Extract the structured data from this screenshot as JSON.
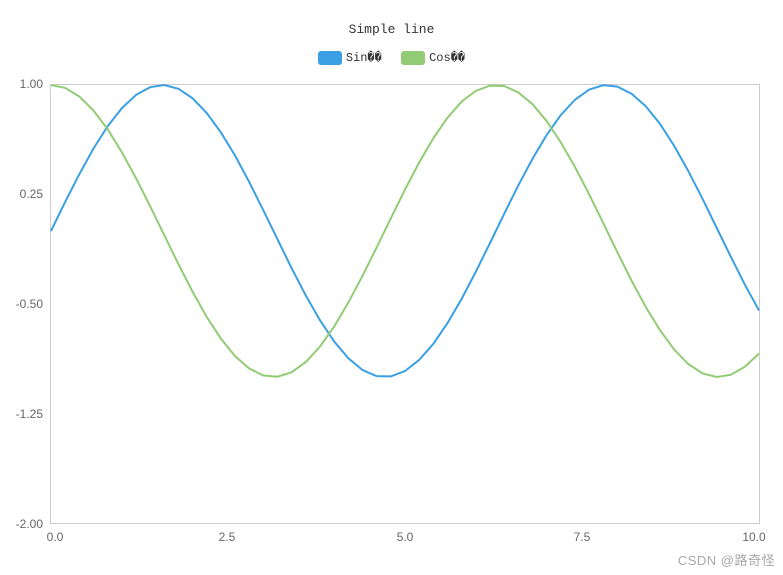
{
  "chart_data": {
    "type": "line",
    "title": "Simple line",
    "xlabel": "",
    "ylabel": "",
    "xlim": [
      0.0,
      10.0
    ],
    "ylim": [
      -2.0,
      1.0
    ],
    "x_ticks": [
      0.0,
      2.5,
      5.0,
      7.5,
      10.0
    ],
    "y_ticks": [
      1.0,
      0.25,
      -0.5,
      -1.25,
      -2.0
    ],
    "x_tick_labels": [
      "0.0",
      "2.5",
      "5.0",
      "7.5",
      "10.0"
    ],
    "y_tick_labels": [
      "1.00",
      "0.25",
      "-0.50",
      "-1.25",
      "-2.00"
    ],
    "x": [
      0.0,
      0.2,
      0.4,
      0.6,
      0.8,
      1.0,
      1.2,
      1.4,
      1.6,
      1.8,
      2.0,
      2.2,
      2.4,
      2.6,
      2.8,
      3.0,
      3.2,
      3.4,
      3.6,
      3.8,
      4.0,
      4.2,
      4.4,
      4.6,
      4.8,
      5.0,
      5.2,
      5.4,
      5.6,
      5.8,
      6.0,
      6.2,
      6.4,
      6.6,
      6.8,
      7.0,
      7.2,
      7.4,
      7.6,
      7.8,
      8.0,
      8.2,
      8.4,
      8.6,
      8.8,
      9.0,
      9.2,
      9.4,
      9.6,
      9.8,
      10.0
    ],
    "series": [
      {
        "name": "Sin��",
        "color": "#3ba0e3",
        "values": [
          0.0,
          0.199,
          0.389,
          0.565,
          0.717,
          0.841,
          0.932,
          0.985,
          1.0,
          0.974,
          0.909,
          0.808,
          0.675,
          0.516,
          0.335,
          0.141,
          -0.058,
          -0.256,
          -0.443,
          -0.612,
          -0.757,
          -0.872,
          -0.952,
          -0.994,
          -0.996,
          -0.959,
          -0.883,
          -0.773,
          -0.631,
          -0.465,
          -0.279,
          -0.083,
          0.117,
          0.312,
          0.494,
          0.657,
          0.794,
          0.899,
          0.968,
          0.999,
          0.989,
          0.94,
          0.855,
          0.735,
          0.585,
          0.412,
          0.223,
          0.024,
          -0.174,
          -0.367,
          -0.544
        ]
      },
      {
        "name": "Cos��",
        "color": "#91cc75",
        "values": [
          1.0,
          0.98,
          0.921,
          0.825,
          0.697,
          0.54,
          0.362,
          0.17,
          -0.029,
          -0.227,
          -0.416,
          -0.589,
          -0.737,
          -0.857,
          -0.942,
          -0.99,
          -0.998,
          -0.967,
          -0.897,
          -0.791,
          -0.654,
          -0.49,
          -0.307,
          -0.112,
          0.087,
          0.284,
          0.469,
          0.635,
          0.776,
          0.886,
          0.96,
          0.996,
          0.993,
          0.95,
          0.869,
          0.754,
          0.608,
          0.439,
          0.252,
          0.054,
          -0.146,
          -0.34,
          -0.52,
          -0.678,
          -0.811,
          -0.911,
          -0.975,
          -1.0,
          -0.985,
          -0.93,
          -0.839
        ]
      }
    ]
  },
  "legend": {
    "items": [
      "Sin��",
      "Cos��"
    ]
  },
  "watermark": "CSDN @路奇怪"
}
